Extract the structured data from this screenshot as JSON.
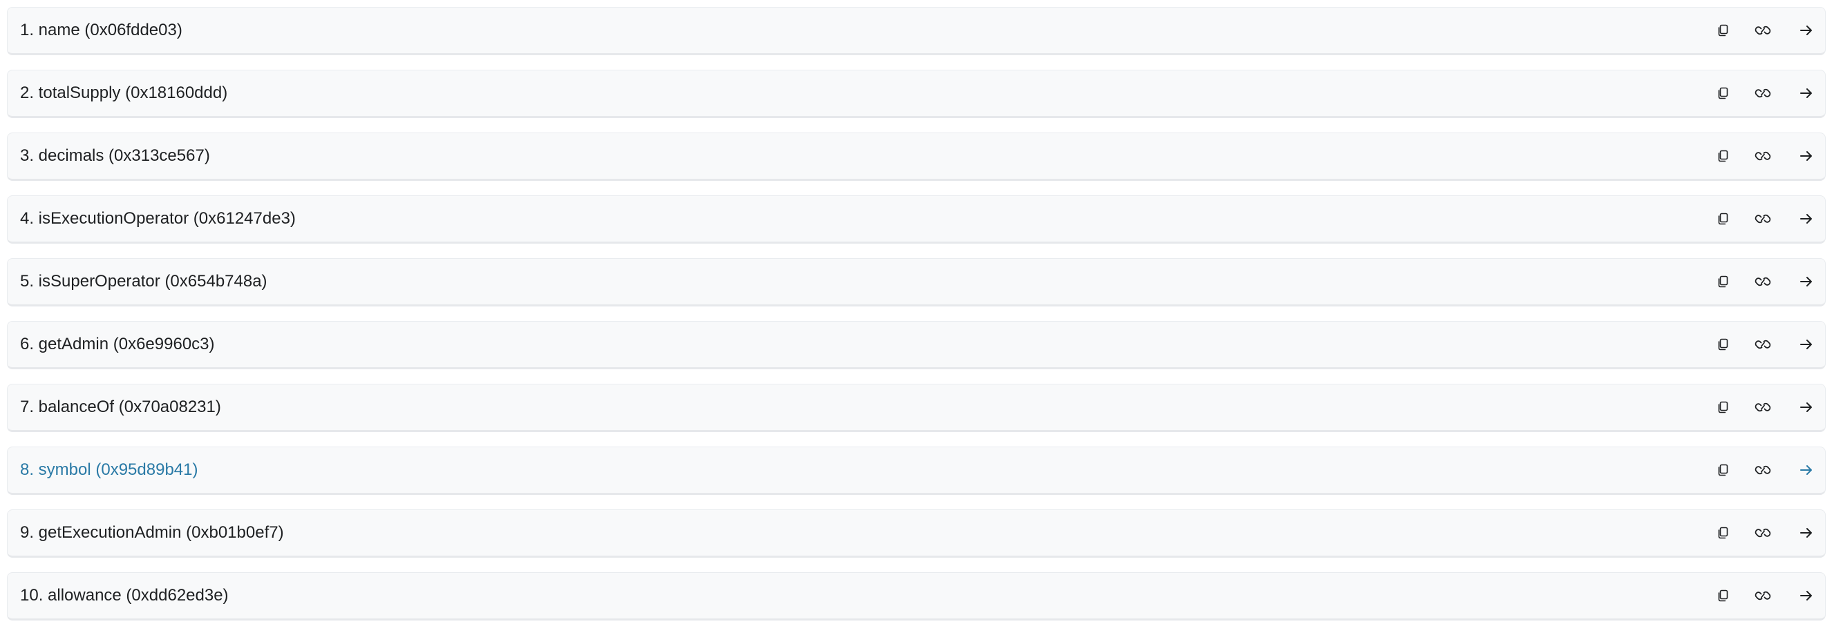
{
  "functions": [
    {
      "label": "1. name (0x06fdde03)",
      "active": false
    },
    {
      "label": "2. totalSupply (0x18160ddd)",
      "active": false
    },
    {
      "label": "3. decimals (0x313ce567)",
      "active": false
    },
    {
      "label": "4. isExecutionOperator (0x61247de3)",
      "active": false
    },
    {
      "label": "5. isSuperOperator (0x654b748a)",
      "active": false
    },
    {
      "label": "6. getAdmin (0x6e9960c3)",
      "active": false
    },
    {
      "label": "7. balanceOf (0x70a08231)",
      "active": false
    },
    {
      "label": "8. symbol (0x95d89b41)",
      "active": true
    },
    {
      "label": "9. getExecutionAdmin (0xb01b0ef7)",
      "active": false
    },
    {
      "label": "10. allowance (0xdd62ed3e)",
      "active": false
    }
  ],
  "icons": {
    "copy": "copy-icon",
    "link": "link-icon",
    "arrow": "arrow-right-icon"
  },
  "colors": {
    "text": "#1e2022",
    "accent": "#2a7aa6",
    "row_bg": "#f8f9fa",
    "row_border": "#e9ecef"
  }
}
